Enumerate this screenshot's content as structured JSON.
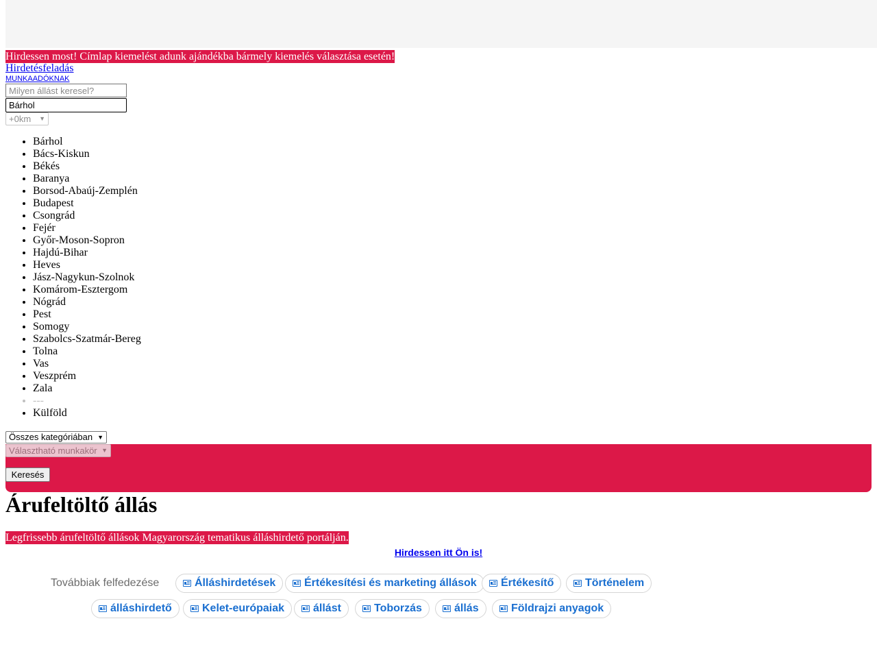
{
  "banner": {
    "promo_text": "Hirdessen most! Címlap kiemelést adunk ajándékba bármely kiemelés választása esetén!"
  },
  "nav": {
    "post_ad_link": "Hirdetésfeladás",
    "employers_link": "MUNKAADÓKNAK"
  },
  "search": {
    "job_placeholder": "Milyen állást keresel?",
    "location_value": "Bárhol",
    "radius_value": "+0km",
    "counties": [
      "Bárhol",
      "Bács-Kiskun",
      "Békés",
      "Baranya",
      "Borsod-Abaúj-Zemplén",
      "Budapest",
      "Csongrád",
      "Fejér",
      "Győr-Moson-Sopron",
      "Hajdú-Bihar",
      "Heves",
      "Jász-Nagykun-Szolnok",
      "Komárom-Esztergom",
      "Nógrád",
      "Pest",
      "Somogy",
      "Szabolcs-Szatmár-Bereg",
      "Tolna",
      "Vas",
      "Veszprém",
      "Zala",
      "---",
      "Külföld"
    ],
    "category_value": "Összes kategóriában",
    "role_value": "Választható munkakör",
    "search_button": "Keresés"
  },
  "page": {
    "title": "Árufeltöltő állás",
    "subtitle": "Legfrissebb árufeltöltő állások Magyarország tematikus álláshirdető portálján.",
    "advertise_link": "Hirdessen itt Ön is!"
  },
  "explore": {
    "label": "Továbbiak felfedezése",
    "chips": [
      "Álláshirdetések",
      "Értékesítési és marketing állások",
      "Értékesítő",
      "Történelem",
      "álláshirdető",
      "Kelet-európaiak",
      "állást",
      "Toborzás",
      "állás",
      "Földrajzi anyagok"
    ]
  },
  "colors": {
    "brand_red": "#dc1848",
    "link_blue": "#0000ee",
    "chip_blue": "#1a6fd0"
  }
}
